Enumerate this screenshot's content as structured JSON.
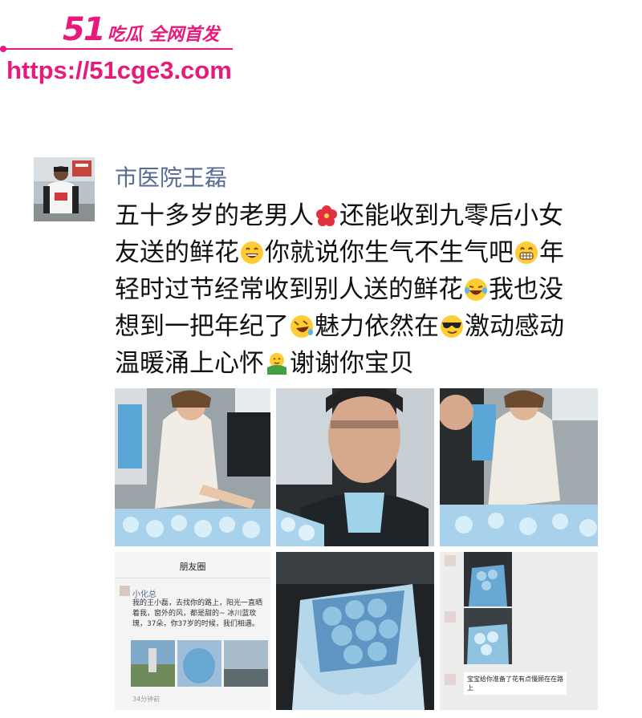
{
  "watermark": {
    "logo_number": "51",
    "logo_text": "吃瓜 全网首发",
    "url": "https://51cge3.com"
  },
  "post": {
    "author": "市医院王磊",
    "lines": [
      {
        "a": "五十多岁的老男人",
        "b": "还能收到九零后小女",
        "e": "flower-emoji"
      },
      {
        "a": "友送的鲜花",
        "b": "你就说你生气不生气吧",
        "c": "年",
        "e": "smile-emoji",
        "e2": "grin-emoji"
      },
      {
        "a": "轻时过节经常收到别人送的鲜花",
        "b": "我也没",
        "e": "laugh-emoji"
      },
      {
        "a": "想到一把年纪了",
        "b": "魅力依然在",
        "c": "激动感动",
        "e": "tears-emoji",
        "e2": "sunglasses-emoji"
      },
      {
        "a": "温暖涌上心怀",
        "b": "谢谢你宝贝",
        "e": "hug-emoji"
      }
    ]
  },
  "moments_shot": {
    "title": "朋友圈",
    "name": "小化总",
    "text": "我的王小磊，去找你的路上，阳光一直晒着我，窗外的风，都是甜的~ 冰川蓝玫瑰，37朵，你37岁的时候，我们相遇。",
    "time": "34分钟前"
  },
  "chat_shot": {
    "message": "宝宝给你准备了花有点慢顾在在路上"
  },
  "colors": {
    "watermark": "#e8197a",
    "author_name": "#576b95",
    "bouquet_blue": "#8fc3e0"
  }
}
